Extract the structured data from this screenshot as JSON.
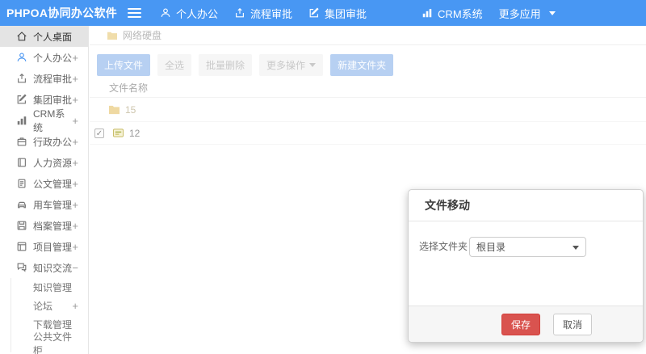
{
  "topbar": {
    "logo": "PHPOA协同办公软件",
    "nav": [
      {
        "label": "个人办公",
        "icon": "user-icon"
      },
      {
        "label": "流程审批",
        "icon": "process-icon"
      },
      {
        "label": "集团审批",
        "icon": "edit-icon"
      },
      {
        "label": "CRM系统",
        "icon": "chart-icon"
      },
      {
        "label": "更多应用",
        "icon": "caret-down-icon"
      }
    ]
  },
  "sidebar": {
    "items": [
      {
        "label": "个人桌面",
        "icon": "home-icon",
        "expand": "",
        "active": true
      },
      {
        "label": "个人办公",
        "icon": "user-icon",
        "expand": "+"
      },
      {
        "label": "流程审批",
        "icon": "process-icon",
        "expand": "+"
      },
      {
        "label": "集团审批",
        "icon": "edit-icon",
        "expand": "+"
      },
      {
        "label": "CRM系统",
        "icon": "chart-icon",
        "expand": "+"
      },
      {
        "label": "行政办公",
        "icon": "briefcase-icon",
        "expand": "+"
      },
      {
        "label": "人力资源",
        "icon": "book-icon",
        "expand": "+"
      },
      {
        "label": "公文管理",
        "icon": "doc-icon",
        "expand": "+"
      },
      {
        "label": "用车管理",
        "icon": "car-icon",
        "expand": "+"
      },
      {
        "label": "档案管理",
        "icon": "archive-icon",
        "expand": "+"
      },
      {
        "label": "项目管理",
        "icon": "project-icon",
        "expand": "+"
      },
      {
        "label": "知识交流",
        "icon": "chat-icon",
        "expand": "−"
      }
    ],
    "subitems": [
      {
        "label": "知识管理",
        "expand": ""
      },
      {
        "label": "论坛",
        "expand": "+"
      },
      {
        "label": "下载管理",
        "expand": ""
      },
      {
        "label": "公共文件柜",
        "expand": ""
      }
    ]
  },
  "breadcrumb": {
    "label": "网络硬盘"
  },
  "toolbar": {
    "upload": "上传文件",
    "select_all": "全选",
    "batch_delete": "批量删除",
    "more_ops": "更多操作",
    "new_folder": "新建文件夹"
  },
  "file_table": {
    "header": "文件名称",
    "rows": [
      {
        "name": "15",
        "type": "folder",
        "checked": false,
        "faded": true
      },
      {
        "name": "12",
        "type": "file",
        "checked": true,
        "faded": false
      }
    ]
  },
  "modal": {
    "title": "文件移动",
    "folder_label": "选择文件夹",
    "folder_value": "根目录",
    "save": "保存",
    "cancel": "取消"
  },
  "colors": {
    "brand_blue": "#4897f3",
    "save_red": "#d9534f",
    "folder_yellow": "#f3d781",
    "active_item_bg": "#e4e4e4"
  }
}
